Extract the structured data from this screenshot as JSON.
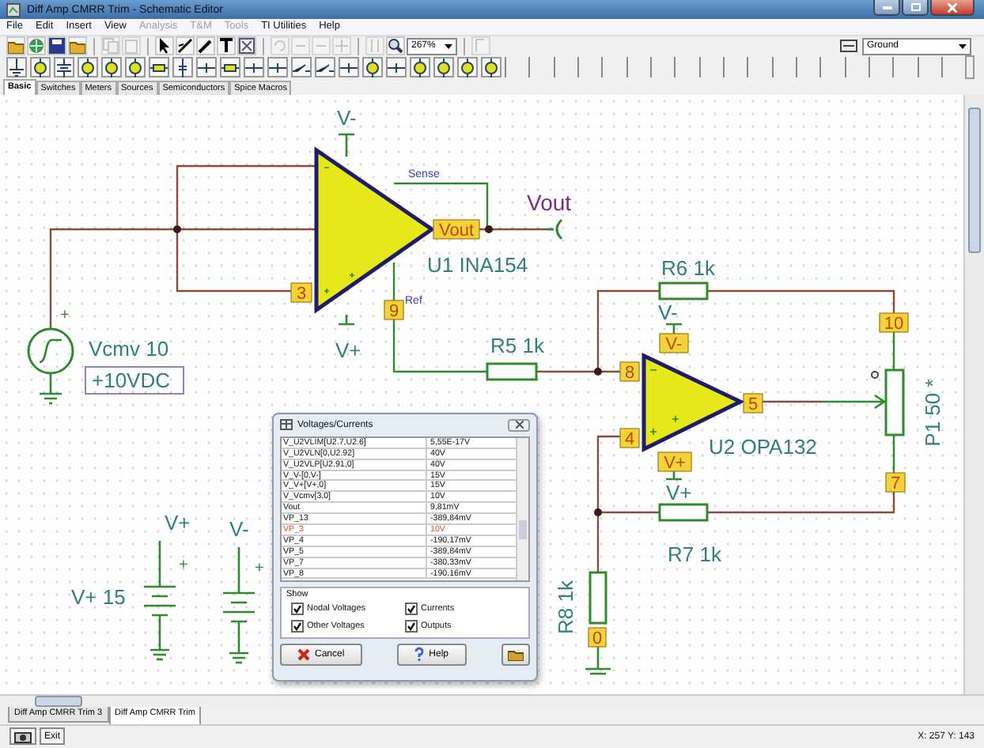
{
  "window": {
    "title": "Diff Amp CMRR Trim - Schematic Editor"
  },
  "menu": [
    {
      "label": "File",
      "disabled": false
    },
    {
      "label": "Edit",
      "disabled": false
    },
    {
      "label": "Insert",
      "disabled": false
    },
    {
      "label": "View",
      "disabled": false
    },
    {
      "label": "Analysis",
      "disabled": true
    },
    {
      "label": "T&M",
      "disabled": true
    },
    {
      "label": "Tools",
      "disabled": true
    },
    {
      "label": "TI Utilities",
      "disabled": false
    },
    {
      "label": "Help",
      "disabled": false
    }
  ],
  "toolbar": {
    "zoom": "267%",
    "component_select": "Ground"
  },
  "component_tabs": [
    {
      "label": "Basic",
      "selected": true
    },
    {
      "label": "Switches",
      "selected": false
    },
    {
      "label": "Meters",
      "selected": false
    },
    {
      "label": "Sources",
      "selected": false
    },
    {
      "label": "Semiconductors",
      "selected": false
    },
    {
      "label": "Spice Macros",
      "selected": false
    }
  ],
  "schematic": {
    "labels": [
      {
        "text": "V-",
        "kind": "label"
      },
      {
        "text": "Sense",
        "kind": "pin_name"
      },
      {
        "text": "Vout",
        "kind": "net"
      },
      {
        "text": "U1 INA154",
        "kind": "label"
      },
      {
        "text": "Ref",
        "kind": "pin_name"
      },
      {
        "text": "Vcmv 10",
        "kind": "label"
      },
      {
        "text": "V+",
        "kind": "label"
      },
      {
        "text": "R5 1k",
        "kind": "label"
      },
      {
        "text": "R6 1k",
        "kind": "label"
      },
      {
        "text": "V-",
        "kind": "label"
      },
      {
        "text": "U2 OPA132",
        "kind": "label"
      },
      {
        "text": "V+",
        "kind": "label"
      },
      {
        "text": "R7 1k",
        "kind": "label"
      },
      {
        "text": "R8 1k",
        "kind": "vertical"
      },
      {
        "text": "P1 50 *",
        "kind": "vertical"
      },
      {
        "text": "V+ 15",
        "kind": "label"
      },
      {
        "text": "V+",
        "kind": "label"
      },
      {
        "text": "V-",
        "kind": "label"
      },
      {
        "text": "+",
        "kind": "plus"
      },
      {
        "text": "+",
        "kind": "plus"
      },
      {
        "text": "+",
        "kind": "plus"
      },
      {
        "text": "+10VDC",
        "kind": "boxed"
      }
    ],
    "pins": [
      "Vout",
      "3",
      "9",
      "8",
      "4",
      "5",
      "V-",
      "V+",
      "10",
      "7",
      "0"
    ]
  },
  "dialog": {
    "title": "Voltages/Currents",
    "rows": [
      {
        "name": "V_U2VLIM[U2.7,U2.6]",
        "value": "5,55E-17V",
        "selected": false
      },
      {
        "name": "V_U2VLN[0,U2.92]",
        "value": "40V",
        "selected": false
      },
      {
        "name": "V_U2VLP[U2.91,0]",
        "value": "40V",
        "selected": false
      },
      {
        "name": "V_V-[0,V-]",
        "value": "15V",
        "selected": false
      },
      {
        "name": "V_V+[V+,0]",
        "value": "15V",
        "selected": false
      },
      {
        "name": "V_Vcmv[3,0]",
        "value": "10V",
        "selected": false
      },
      {
        "name": "Vout",
        "value": "9,81mV",
        "selected": false
      },
      {
        "name": "VP_13",
        "value": "-389,84mV",
        "selected": false
      },
      {
        "name": "VP_3",
        "value": "10V",
        "selected": true
      },
      {
        "name": "VP_4",
        "value": "-190,17mV",
        "selected": false
      },
      {
        "name": "VP_5",
        "value": "-389,84mV",
        "selected": false
      },
      {
        "name": "VP_7",
        "value": "-380,33mV",
        "selected": false
      },
      {
        "name": "VP_8",
        "value": "-190,16mV",
        "selected": false
      }
    ],
    "show_title": "Show",
    "options": [
      {
        "label": "Nodal Voltages",
        "checked": true
      },
      {
        "label": "Currents",
        "checked": true
      },
      {
        "label": "Other Voltages",
        "checked": true
      },
      {
        "label": "Outputs",
        "checked": true
      }
    ],
    "cancel": "Cancel",
    "help": "Help"
  },
  "sheet_tabs": [
    {
      "label": "Diff Amp CMRR Trim 3",
      "selected": false
    },
    {
      "label": "Diff Amp CMRR Trim",
      "selected": true
    }
  ],
  "status_bar": {
    "exit": "Exit",
    "coordinates": "X: 257  Y: 143"
  }
}
